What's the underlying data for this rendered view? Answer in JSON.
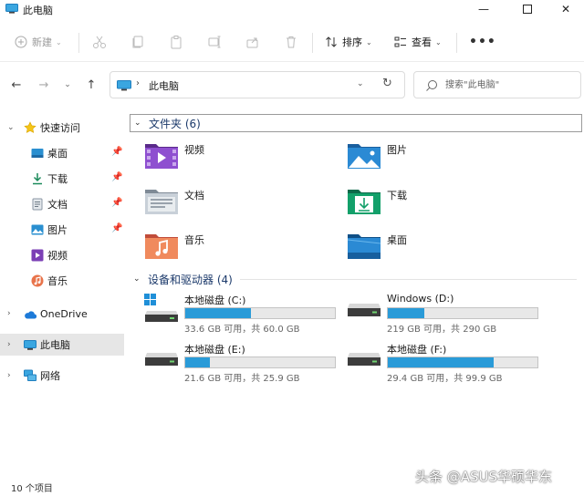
{
  "window": {
    "title": "此电脑"
  },
  "toolbar": {
    "new_label": "新建",
    "sort_label": "排序",
    "view_label": "查看"
  },
  "address": {
    "path": "此电脑"
  },
  "search": {
    "placeholder": "搜索\"此电脑\""
  },
  "sidebar": {
    "quick_access": "快速访问",
    "pinned": [
      {
        "label": "桌面",
        "pinned": true
      },
      {
        "label": "下载",
        "pinned": true
      },
      {
        "label": "文档",
        "pinned": true
      },
      {
        "label": "图片",
        "pinned": true
      },
      {
        "label": "视频",
        "pinned": false
      },
      {
        "label": "音乐",
        "pinned": false
      }
    ],
    "onedrive": "OneDrive",
    "this_pc": "此电脑",
    "network": "网络"
  },
  "groups": {
    "folders_title": "文件夹 (6)",
    "devices_title": "设备和驱动器 (4)"
  },
  "folders": [
    {
      "name": "视频",
      "icon": "video-folder-icon"
    },
    {
      "name": "图片",
      "icon": "pictures-folder-icon"
    },
    {
      "name": "文档",
      "icon": "documents-folder-icon"
    },
    {
      "name": "下载",
      "icon": "downloads-folder-icon"
    },
    {
      "name": "音乐",
      "icon": "music-folder-icon"
    },
    {
      "name": "桌面",
      "icon": "desktop-folder-icon"
    }
  ],
  "drives": [
    {
      "name": "本地磁盘 (C:)",
      "info": "33.6 GB 可用，共 60.0 GB",
      "used_fraction": 0.44,
      "system": true
    },
    {
      "name": "Windows (D:)",
      "info": "219 GB 可用，共 290 GB",
      "used_fraction": 0.245,
      "system": false
    },
    {
      "name": "本地磁盘 (E:)",
      "info": "21.6 GB 可用，共 25.9 GB",
      "used_fraction": 0.166,
      "system": false
    },
    {
      "name": "本地磁盘 (F:)",
      "info": "29.4 GB 可用，共 99.9 GB",
      "used_fraction": 0.706,
      "system": false
    }
  ],
  "status": {
    "item_count": "10 个项目"
  },
  "watermark": "头条 @ASUS华硕华东",
  "colors": {
    "accent": "#2a9bd8",
    "group_title": "#1c3a6b",
    "selected": "#e6e6e6"
  }
}
